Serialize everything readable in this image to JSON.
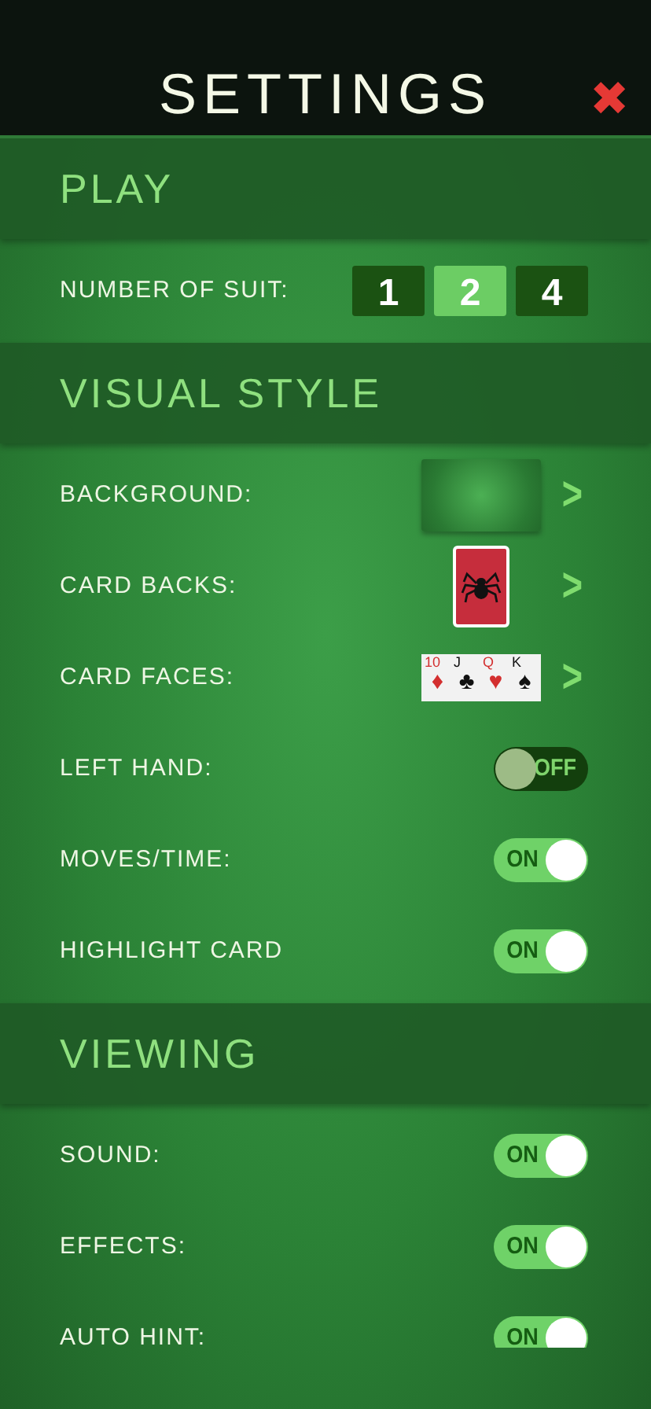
{
  "header": {
    "title": "SETTINGS",
    "close": "✖"
  },
  "sections": [
    {
      "title": "PLAY",
      "rows": [
        {
          "kind": "suits",
          "label": "NUMBER OF SUIT:",
          "options": [
            {
              "label": "1",
              "selected": false
            },
            {
              "label": "2",
              "selected": true
            },
            {
              "label": "4",
              "selected": false
            }
          ]
        }
      ]
    },
    {
      "title": "VISUAL STYLE",
      "rows": [
        {
          "kind": "background",
          "label": "BACKGROUND:",
          "arrow": ">"
        },
        {
          "kind": "card_back",
          "label": "CARD BACKS:",
          "arrow": ">"
        },
        {
          "kind": "card_faces",
          "label": "CARD FACES:",
          "arrow": ">",
          "cards": [
            {
              "rank": "10",
              "suit": "♦",
              "color": "#d32f2f"
            },
            {
              "rank": "J",
              "suit": "♣",
              "color": "#111111"
            },
            {
              "rank": "Q",
              "suit": "♥",
              "color": "#d32f2f"
            },
            {
              "rank": "K",
              "suit": "♠",
              "color": "#111111"
            }
          ]
        },
        {
          "kind": "toggle",
          "label": "LEFT HAND:",
          "on": false,
          "state_text": "OFF"
        },
        {
          "kind": "toggle",
          "label": "MOVES/TIME:",
          "on": true,
          "state_text": "ON"
        },
        {
          "kind": "toggle",
          "label": "HIGHLIGHT CARD",
          "on": true,
          "state_text": "ON"
        }
      ]
    },
    {
      "title": "VIEWING",
      "rows": [
        {
          "kind": "toggle",
          "label": "SOUND:",
          "on": true,
          "state_text": "ON"
        },
        {
          "kind": "toggle",
          "label": "EFFECTS:",
          "on": true,
          "state_text": "ON"
        },
        {
          "kind": "toggle",
          "label": "AUTO HINT:",
          "on": true,
          "state_text": "ON"
        }
      ]
    }
  ]
}
